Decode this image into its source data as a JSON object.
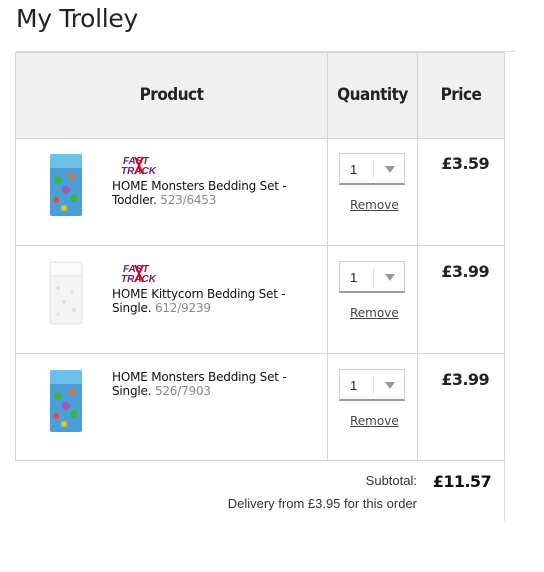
{
  "page": {
    "title": "My Trolley"
  },
  "table": {
    "headers": {
      "product": "Product",
      "quantity": "Quantity",
      "price": "Price"
    },
    "rows": [
      {
        "fast_track": true,
        "name": "HOME Monsters Bedding Set - Toddler.",
        "sku": "523/6453",
        "quantity": "1",
        "remove_label": "Remove",
        "price": "£3.59",
        "thumb_icon": "monsters-bedding-thumbnail"
      },
      {
        "fast_track": true,
        "name": "HOME Kittycorn Bedding Set - Single.",
        "sku": "612/9239",
        "quantity": "1",
        "remove_label": "Remove",
        "price": "£3.99",
        "thumb_icon": "kittycorn-bedding-thumbnail"
      },
      {
        "fast_track": false,
        "name": "HOME Monsters Bedding Set - Single.",
        "sku": "526/7903",
        "quantity": "1",
        "remove_label": "Remove",
        "price": "£3.99",
        "thumb_icon": "monsters-bedding-thumbnail"
      }
    ]
  },
  "fast_track_badge": {
    "line1": "FAST",
    "line2": "TRACK"
  },
  "summary": {
    "subtotal_label": "Subtotal:",
    "subtotal_value": "£11.57",
    "delivery_text": "Delivery from £3.95 for this order"
  },
  "colors": {
    "fast_red": "#e2001a",
    "fast_purple": "#6b1f7c",
    "price_text": "#222222"
  }
}
